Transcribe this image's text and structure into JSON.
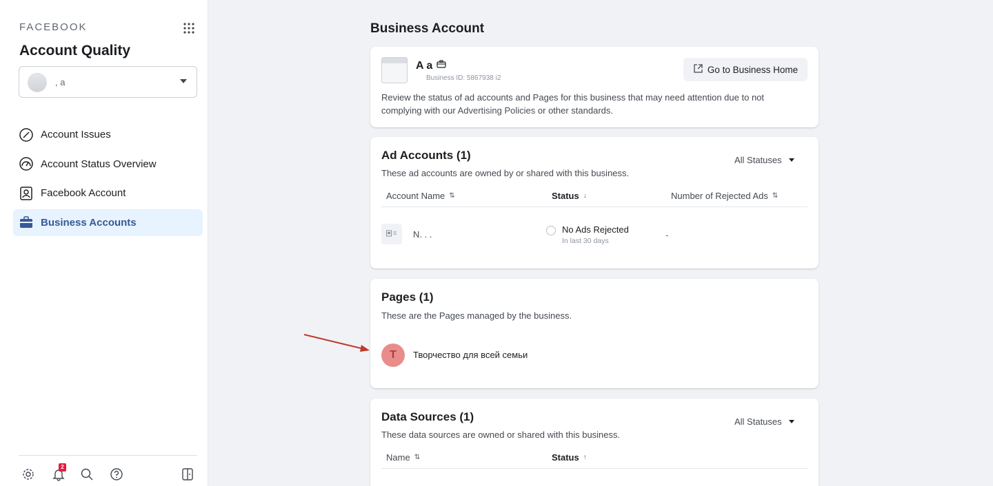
{
  "sidebar": {
    "brand": "FACEBOOK",
    "title": "Account Quality",
    "account_selector": {
      "name": ",      a"
    },
    "nav": [
      {
        "label": "Account Issues",
        "icon": "slash-circle-icon",
        "active": false
      },
      {
        "label": "Account Status Overview",
        "icon": "gauge-icon",
        "active": false
      },
      {
        "label": "Facebook Account",
        "icon": "profile-card-icon",
        "active": false
      },
      {
        "label": "Business Accounts",
        "icon": "briefcase-icon",
        "active": true
      }
    ],
    "footer": {
      "notification_count": "2"
    }
  },
  "main": {
    "title": "Business Account",
    "business": {
      "name": "A      a",
      "id_text": "Business ID: 5867938          i2",
      "go_home_label": "Go to Business Home",
      "desc_before": "Review the status of ad accounts and Pages for this business that may need attention due to not complying with our ",
      "desc_link": "Advertising Policies",
      "desc_after": " or other standards."
    },
    "ad_accounts": {
      "title": "Ad Accounts (1)",
      "subtitle": "These ad accounts are owned by or shared with this business.",
      "filter": "All Statuses",
      "columns": [
        "Account Name",
        "Status",
        "Number of Rejected Ads"
      ],
      "rows": [
        {
          "name": "N. . .",
          "status": "No Ads Rejected",
          "status_sub": "In last 30 days",
          "rejected": "-"
        }
      ]
    },
    "pages": {
      "title": "Pages (1)",
      "subtitle": "These are the Pages managed by the business.",
      "items": [
        {
          "initial": "T",
          "name": "Творчество для всей семьи"
        }
      ]
    },
    "data_sources": {
      "title": "Data Sources (1)",
      "subtitle": "These data sources are owned or shared with this business.",
      "filter": "All Statuses",
      "columns": [
        "Name",
        "Status"
      ]
    }
  },
  "colors": {
    "accent": "#385898",
    "active_bg": "#e7f3ff",
    "annotation_arrow": "#c0392b"
  }
}
